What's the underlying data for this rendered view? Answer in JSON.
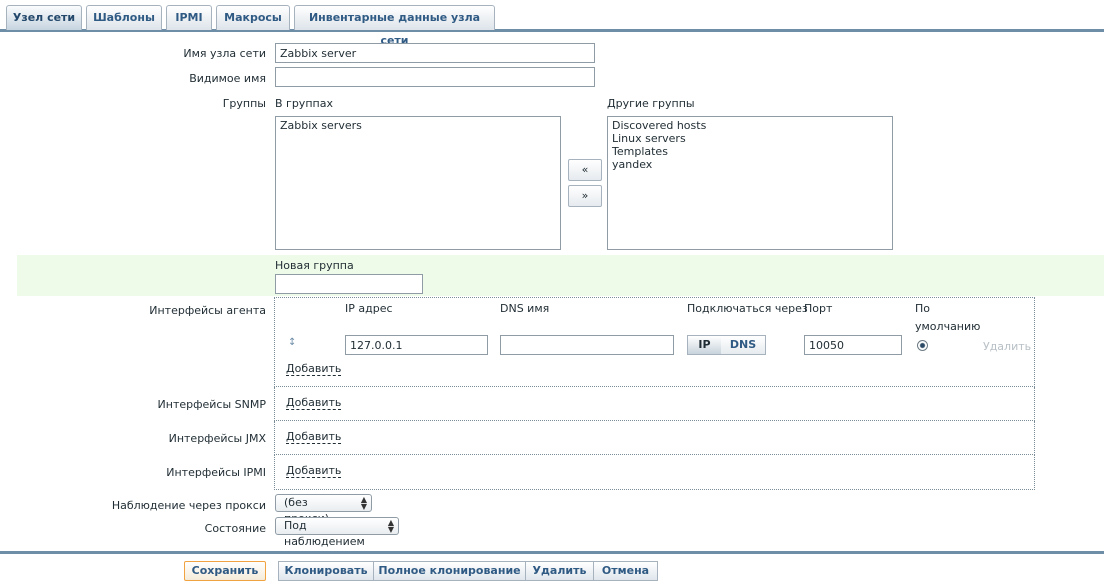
{
  "tabs": [
    {
      "label": "Узел сети",
      "active": true
    },
    {
      "label": "Шаблоны"
    },
    {
      "label": "IPMI"
    },
    {
      "label": "Макросы"
    },
    {
      "label": "Инвентарные данные узла сети"
    }
  ],
  "host": {
    "name_label": "Имя узла сети",
    "name_value": "Zabbix server",
    "visible_label": "Видимое имя",
    "visible_value": ""
  },
  "groups": {
    "label": "Группы",
    "in_groups_label": "В группах",
    "in_groups": [
      "Zabbix servers"
    ],
    "other_groups_label": "Другие группы",
    "other_groups": [
      "Discovered hosts",
      "Linux servers",
      "Templates",
      "yandex"
    ],
    "move_left": "«",
    "move_right": "»",
    "new_group_label": "Новая группа",
    "new_group_value": ""
  },
  "interfaces": {
    "agent_label": "Интерфейсы агента",
    "col_ip": "IP адрес",
    "col_dns": "DNS имя",
    "col_connect": "Подключаться через",
    "col_port": "Порт",
    "col_default_1": "По",
    "col_default_2": "умолчанию",
    "ip_value": "127.0.0.1",
    "dns_value": "",
    "connect_ip": "IP",
    "connect_dns": "DNS",
    "port_value": "10050",
    "remove": "Удалить",
    "add": "Добавить",
    "snmp_label": "Интерфейсы SNMP",
    "jmx_label": "Интерфейсы JMX",
    "ipmi_label": "Интерфейсы IPMI",
    "drag_glyph": "↕"
  },
  "proxy": {
    "label": "Наблюдение через прокси",
    "value": "(без прокси)"
  },
  "status": {
    "label": "Состояние",
    "value": "Под наблюдением"
  },
  "buttons": {
    "save": "Сохранить",
    "clone": "Клонировать",
    "full_clone": "Полное клонирование",
    "delete": "Удалить",
    "cancel": "Отмена"
  },
  "colors": {
    "accent": "#6e8ea8",
    "tab_text": "#2f5a84",
    "highlight_row": "#eefbe9",
    "save_border": "#f0a340"
  }
}
